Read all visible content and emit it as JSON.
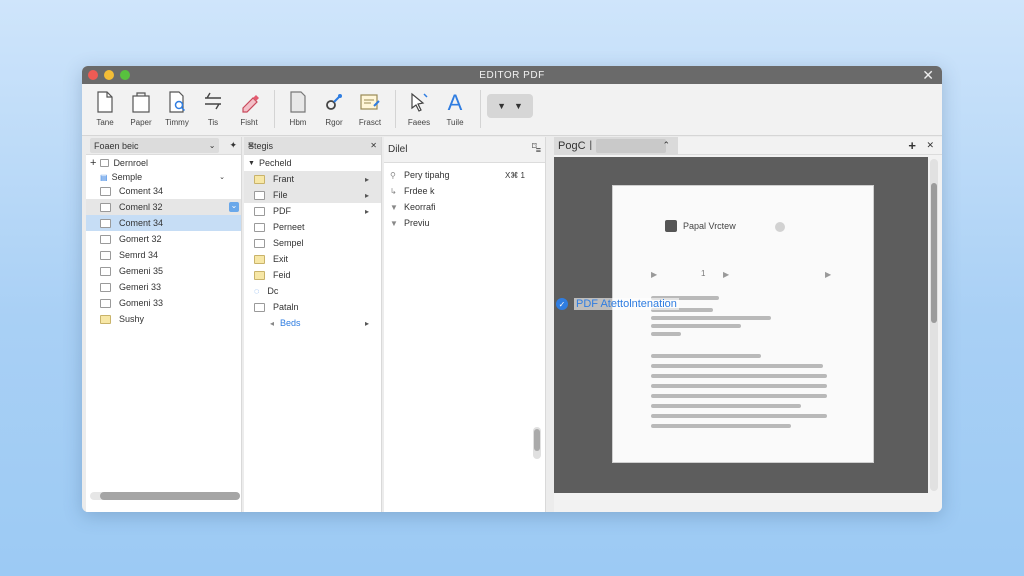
{
  "window": {
    "title": "EDITOR PDF",
    "close_glyph": "✕"
  },
  "toolbar": {
    "tools": [
      {
        "label": "Tane",
        "icon": "blank-page-icon"
      },
      {
        "label": "Paper",
        "icon": "paper-stack-icon"
      },
      {
        "label": "Timmy",
        "icon": "document-search-icon"
      },
      {
        "label": "Tis",
        "icon": "split-icon"
      },
      {
        "label": "Fisht",
        "icon": "eraser-icon"
      },
      {
        "label": "Hbm",
        "icon": "page-icon"
      },
      {
        "label": "Rgor",
        "icon": "link-icon"
      },
      {
        "label": "Frasct",
        "icon": "image-edit-icon"
      },
      {
        "label": "Faees",
        "icon": "cursor-icon"
      },
      {
        "label": "Tuile",
        "icon": "text-icon"
      }
    ],
    "dropdown": {
      "left": "▼",
      "right": "▼"
    }
  },
  "panel1": {
    "combo": "Foaen beic",
    "pin": "✦",
    "tree": {
      "expand": "+",
      "root": "Dernroel",
      "sub": "Semple",
      "items": [
        {
          "label": "Coment 34",
          "state": ""
        },
        {
          "label": "Comenl 32",
          "state": "hl"
        },
        {
          "label": "Coment 34",
          "state": "sel"
        },
        {
          "label": "Gomert 32",
          "state": ""
        },
        {
          "label": "Semrd 34",
          "state": ""
        },
        {
          "label": "Gemeni 35",
          "state": ""
        },
        {
          "label": "Gemeri 33",
          "state": ""
        },
        {
          "label": "Gomeni 33",
          "state": ""
        },
        {
          "label": "Sushy",
          "state": "folder"
        }
      ]
    },
    "menu_icon": "≡"
  },
  "panel2": {
    "header": "Stegis",
    "close": "✕",
    "group": "Pecheld",
    "items": [
      {
        "label": "Frant",
        "arrow": "▸"
      },
      {
        "label": "File",
        "arrow": "▸"
      },
      {
        "label": "PDF",
        "arrow": "▸"
      },
      {
        "label": "Perneet",
        "arrow": ""
      },
      {
        "label": "Sempel",
        "arrow": ""
      },
      {
        "label": "Exit",
        "arrow": ""
      },
      {
        "label": "Feid",
        "arrow": ""
      },
      {
        "label": "Dc",
        "arrow": ""
      },
      {
        "label": "Pataln",
        "arrow": ""
      },
      {
        "label": "Beds",
        "arrow": "▸"
      }
    ]
  },
  "panel3": {
    "header": "Dilel",
    "menu": "≡",
    "items": [
      {
        "label": "Pery tipahg",
        "shortcut": "X⌘ 1"
      },
      {
        "label": "Frdee k",
        "shortcut": ""
      },
      {
        "label": "Keorrafi",
        "shortcut": ""
      },
      {
        "label": "Previu",
        "shortcut": ""
      }
    ],
    "pin": "⌑"
  },
  "viewer": {
    "tab_label": "PogC",
    "tab_cursor": "|",
    "tab_up": "⌃",
    "add": "+",
    "close": "✕",
    "page_title": "Papal Vrctew",
    "pager": {
      "middle": "1"
    },
    "badge_text": "PDF Atettolntenation",
    "accent": "#2f7de1"
  }
}
